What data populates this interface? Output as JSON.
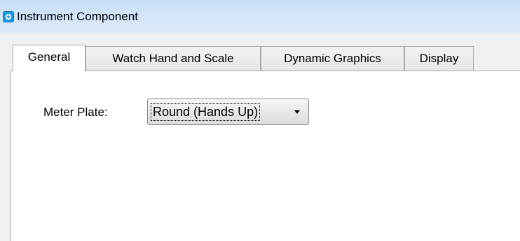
{
  "window": {
    "title": "Instrument Component",
    "icon": "app-icon"
  },
  "tabs": [
    {
      "label": "General",
      "selected": true
    },
    {
      "label": "Watch Hand and Scale",
      "selected": false
    },
    {
      "label": "Dynamic Graphics",
      "selected": false
    },
    {
      "label": "Display",
      "selected": false
    }
  ],
  "general": {
    "meter_plate_label": "Meter Plate:",
    "meter_plate_value": "Round (Hands Up)"
  }
}
